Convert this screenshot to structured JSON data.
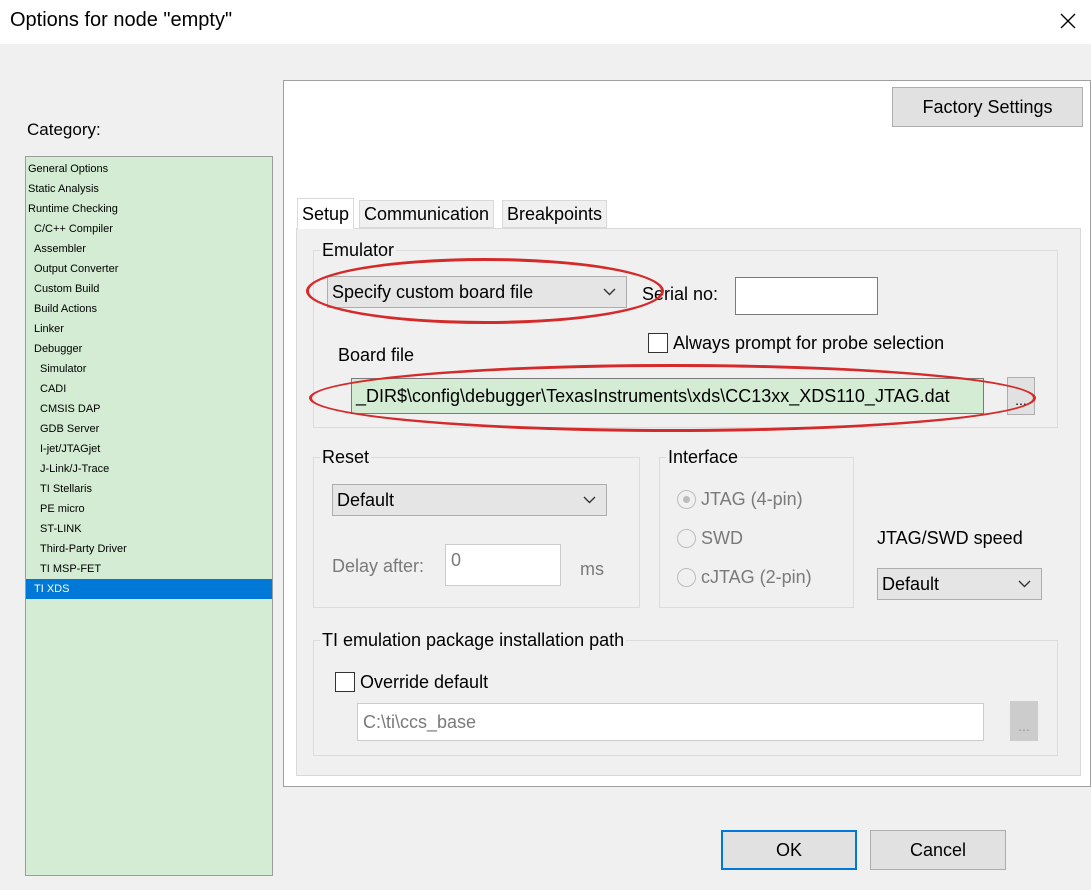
{
  "window": {
    "title": "Options for node \"empty\""
  },
  "category": {
    "label": "Category:",
    "items": [
      {
        "label": "General Options",
        "indent": 0
      },
      {
        "label": "Static Analysis",
        "indent": 0
      },
      {
        "label": "Runtime Checking",
        "indent": 0
      },
      {
        "label": "C/C++ Compiler",
        "indent": 1
      },
      {
        "label": "Assembler",
        "indent": 1
      },
      {
        "label": "Output Converter",
        "indent": 1
      },
      {
        "label": "Custom Build",
        "indent": 1
      },
      {
        "label": "Build Actions",
        "indent": 1
      },
      {
        "label": "Linker",
        "indent": 1
      },
      {
        "label": "Debugger",
        "indent": 1
      },
      {
        "label": "Simulator",
        "indent": 2
      },
      {
        "label": "CADI",
        "indent": 2
      },
      {
        "label": "CMSIS DAP",
        "indent": 2
      },
      {
        "label": "GDB Server",
        "indent": 2
      },
      {
        "label": "I-jet/JTAGjet",
        "indent": 2
      },
      {
        "label": "J-Link/J-Trace",
        "indent": 2
      },
      {
        "label": "TI Stellaris",
        "indent": 2
      },
      {
        "label": "PE micro",
        "indent": 2
      },
      {
        "label": "ST-LINK",
        "indent": 2
      },
      {
        "label": "Third-Party Driver",
        "indent": 2
      },
      {
        "label": "TI MSP-FET",
        "indent": 2
      },
      {
        "label": "TI XDS",
        "indent": 1,
        "selected": true
      }
    ]
  },
  "factory_settings": "Factory Settings",
  "tabs": [
    "Setup",
    "Communication",
    "Breakpoints"
  ],
  "emulator": {
    "legend": "Emulator",
    "selected": "Specify custom board file",
    "serial_label": "Serial no:",
    "serial_value": "",
    "always_prompt": "Always prompt for probe selection",
    "board_file_label": "Board file",
    "board_file_value": "_DIR$\\config\\debugger\\TexasInstruments\\xds\\CC13xx_XDS110_JTAG.dat",
    "browse": "..."
  },
  "reset": {
    "legend": "Reset",
    "selected": "Default",
    "delay_label": "Delay after:",
    "delay_value": "0",
    "unit": "ms"
  },
  "interface": {
    "legend": "Interface",
    "options": [
      "JTAG  (4-pin)",
      "SWD",
      "cJTAG  (2-pin)"
    ],
    "selected_index": 0
  },
  "speed": {
    "label": "JTAG/SWD speed",
    "selected": "Default"
  },
  "ti_path": {
    "legend": "TI emulation package installation path",
    "override": "Override default",
    "path": "C:\\ti\\ccs_base",
    "browse": "..."
  },
  "buttons": {
    "ok": "OK",
    "cancel": "Cancel"
  },
  "colors": {
    "tree_bg": "#d3ecd3",
    "selection": "#0078d7",
    "highlight_ellipse": "#d42a2a",
    "board_field_bg": "#d3ecd3"
  }
}
